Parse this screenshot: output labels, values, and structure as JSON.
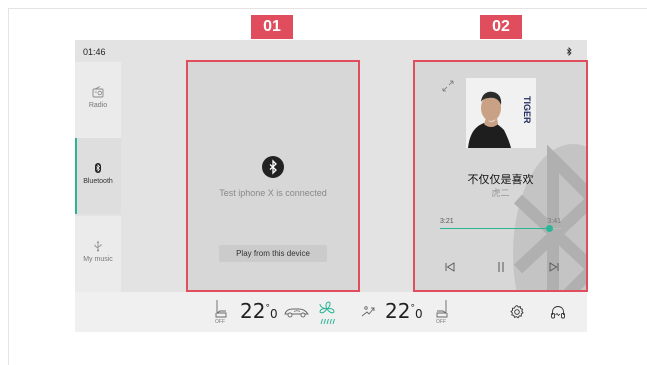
{
  "status": {
    "time": "01:46",
    "bluetooth_icon": "bluetooth-icon"
  },
  "sidebar": {
    "items": [
      {
        "label": "Radio",
        "icon": "radio-icon",
        "active": false
      },
      {
        "label": "Bluetooth",
        "icon": "bluetooth-icon",
        "active": true
      },
      {
        "label": "My music",
        "icon": "usb-icon",
        "active": false
      }
    ],
    "accent_color": "#2bb597"
  },
  "bluetooth_panel": {
    "connected_text": "Test iphone X is connected",
    "play_button": "Play from this device"
  },
  "music_panel": {
    "song_title": "不仅仅是喜欢",
    "artist": "虎二",
    "current_time": "3:21",
    "total_time": "3:41",
    "progress": 0.9,
    "album_art_text": "TIGER",
    "album_art_text_cn": "不仅仅是喜欢 虎二",
    "controls": [
      "previous-icon",
      "pause-icon",
      "next-icon"
    ]
  },
  "callouts": [
    {
      "label": "01",
      "target": "bluetooth-panel"
    },
    {
      "label": "02",
      "target": "music-panel"
    }
  ],
  "climate": {
    "left_temp": "22",
    "left_temp_decimal": "0",
    "right_temp": "22",
    "right_temp_decimal": "0",
    "degree_symbol": "°",
    "left_seat_state": "OFF",
    "right_seat_state": "OFF",
    "fan_color": "#2bb597"
  },
  "callout_color": "#e04d5d"
}
